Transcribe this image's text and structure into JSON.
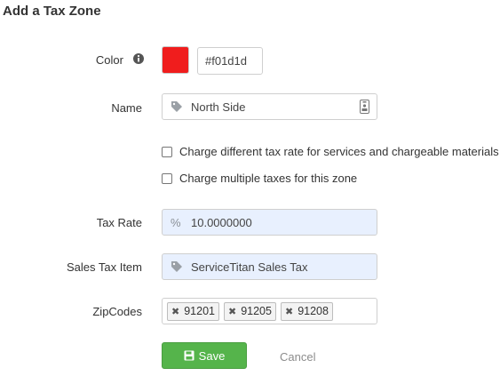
{
  "form": {
    "title": "Add a Tax Zone",
    "color": {
      "label": "Color",
      "info_icon": "info-circle-icon",
      "swatch": "#f01d1d",
      "hex_value": "#f01d1d"
    },
    "name": {
      "label": "Name",
      "icon": "tag-icon",
      "value": "North Side",
      "trailing_icon": "id-badge-icon"
    },
    "options": [
      {
        "label": "Charge different tax rate for services and chargeable materials",
        "checked": false
      },
      {
        "label": "Charge multiple taxes for this zone",
        "checked": false
      }
    ],
    "tax_rate": {
      "label": "Tax Rate",
      "prefix": "%",
      "value": "10.0000000"
    },
    "sales_tax_item": {
      "label": "Sales Tax Item",
      "icon": "tag-icon",
      "value": "ServiceTitan Sales Tax"
    },
    "zipcodes": {
      "label": "ZipCodes",
      "remove_glyph": "✖",
      "tags": [
        "91201",
        "91205",
        "91208"
      ]
    },
    "save_label": "Save",
    "save_icon": "floppy-disk-icon",
    "cancel_label": "Cancel",
    "colors": {
      "accent_green": "#55b44b",
      "field_blue": "#e8f0fe"
    }
  }
}
